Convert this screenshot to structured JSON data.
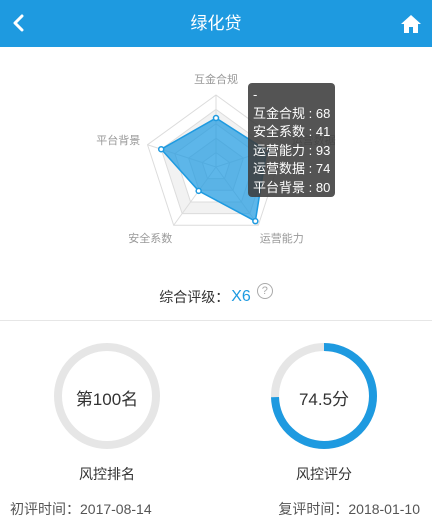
{
  "header": {
    "title": "绿化贷",
    "back_icon": "chevron-left-icon",
    "home_icon": "home-icon",
    "bg_color": "#1e9ae0"
  },
  "radar": {
    "axes": [
      {
        "label": "互金合规",
        "value": 68
      },
      {
        "label": "运营数据",
        "value": 74
      },
      {
        "label": "运营能力",
        "value": 93
      },
      {
        "label": "安全系数",
        "value": 41
      },
      {
        "label": "平台背景",
        "value": 80
      }
    ],
    "max": 100,
    "fill_color": "#1e9ae0"
  },
  "tooltip": {
    "title": "-",
    "rows": [
      "互金合规 : 68",
      "安全系数 : 41",
      "运营能力 : 93",
      "运营数据 : 74",
      "平台背景 : 80"
    ]
  },
  "grade": {
    "label": "综合评级：",
    "value": "X6",
    "help_icon": "question-icon"
  },
  "gauges": [
    {
      "center_text": "第100名",
      "label": "风控排名",
      "progress": 0
    },
    {
      "center_text": "74.5分",
      "label": "风控评分",
      "progress": 0.745
    }
  ],
  "footer": {
    "initial_review": "初评时间：2017-08-14",
    "re_review": "复评时间：2018-01-10"
  }
}
